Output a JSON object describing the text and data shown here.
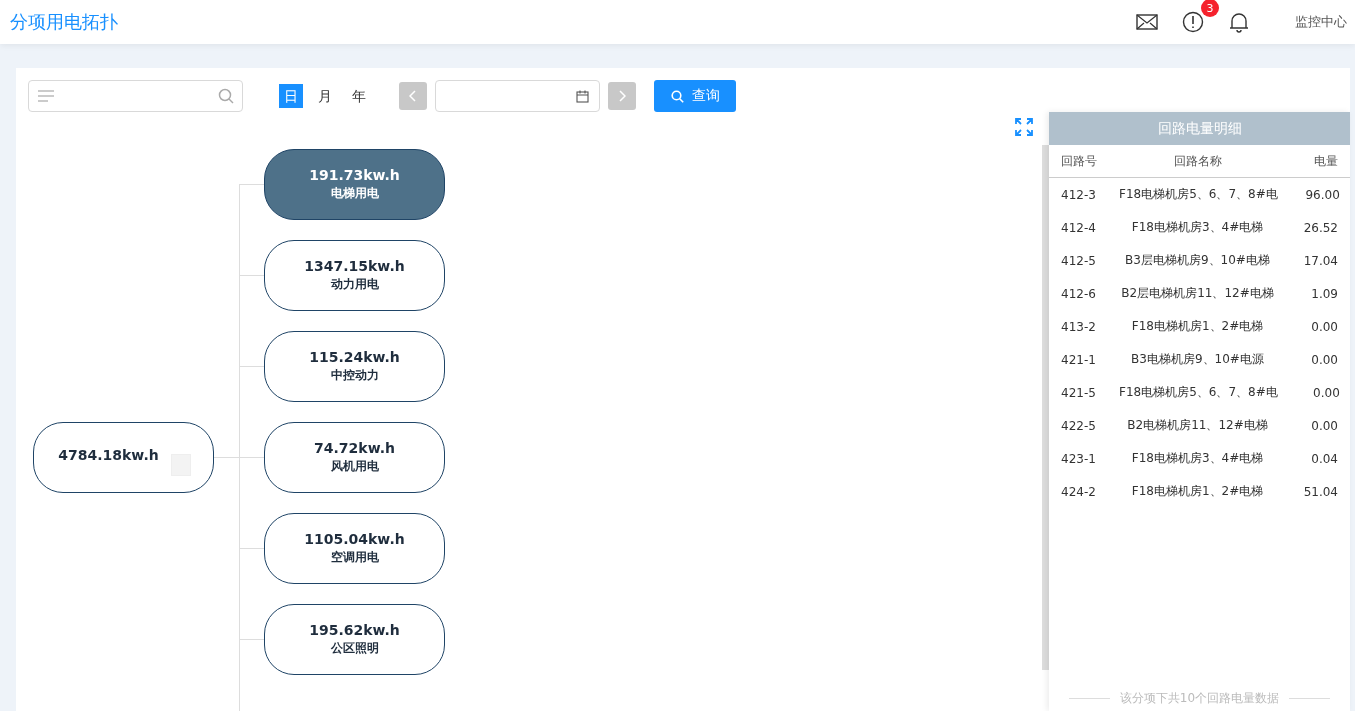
{
  "header": {
    "title": "分项用电拓扑",
    "alert_badge": "3",
    "user": "监控中心"
  },
  "toolbar": {
    "periods": [
      {
        "label": "日",
        "selected": true
      },
      {
        "label": "月",
        "selected": false
      },
      {
        "label": "年",
        "selected": false
      }
    ],
    "query_button": "查询"
  },
  "tree": {
    "root": {
      "value": "4784.18kw.h"
    },
    "children": [
      {
        "value": "191.73kw.h",
        "label": "电梯用电",
        "selected": true
      },
      {
        "value": "1347.15kw.h",
        "label": "动力用电",
        "selected": false
      },
      {
        "value": "115.24kw.h",
        "label": "中控动力",
        "selected": false
      },
      {
        "value": "74.72kw.h",
        "label": "风机用电",
        "selected": false
      },
      {
        "value": "1105.04kw.h",
        "label": "空调用电",
        "selected": false
      },
      {
        "value": "195.62kw.h",
        "label": "公区照明",
        "selected": false
      }
    ]
  },
  "detail_panel": {
    "title": "回路电量明细",
    "columns": [
      "回路号",
      "回路名称",
      "电量"
    ],
    "rows": [
      [
        "412-3",
        "F18电梯机房5、6、7、8#电",
        "96.00"
      ],
      [
        "412-4",
        "F18电梯机房3、4#电梯",
        "26.52"
      ],
      [
        "412-5",
        "B3层电梯机房9、10#电梯",
        "17.04"
      ],
      [
        "412-6",
        "B2层电梯机房11、12#电梯",
        "1.09"
      ],
      [
        "413-2",
        "F18电梯机房1、2#电梯",
        "0.00"
      ],
      [
        "421-1",
        "B3电梯机房9、10#电源",
        "0.00"
      ],
      [
        "421-5",
        "F18电梯机房5、6、7、8#电",
        "0.00"
      ],
      [
        "422-5",
        "B2电梯机房11、12#电梯",
        "0.00"
      ],
      [
        "423-1",
        "F18电梯机房3、4#电梯",
        "0.04"
      ],
      [
        "424-2",
        "F18电梯机房1、2#电梯",
        "51.04"
      ]
    ],
    "footer": "该分项下共10个回路电量数据"
  }
}
